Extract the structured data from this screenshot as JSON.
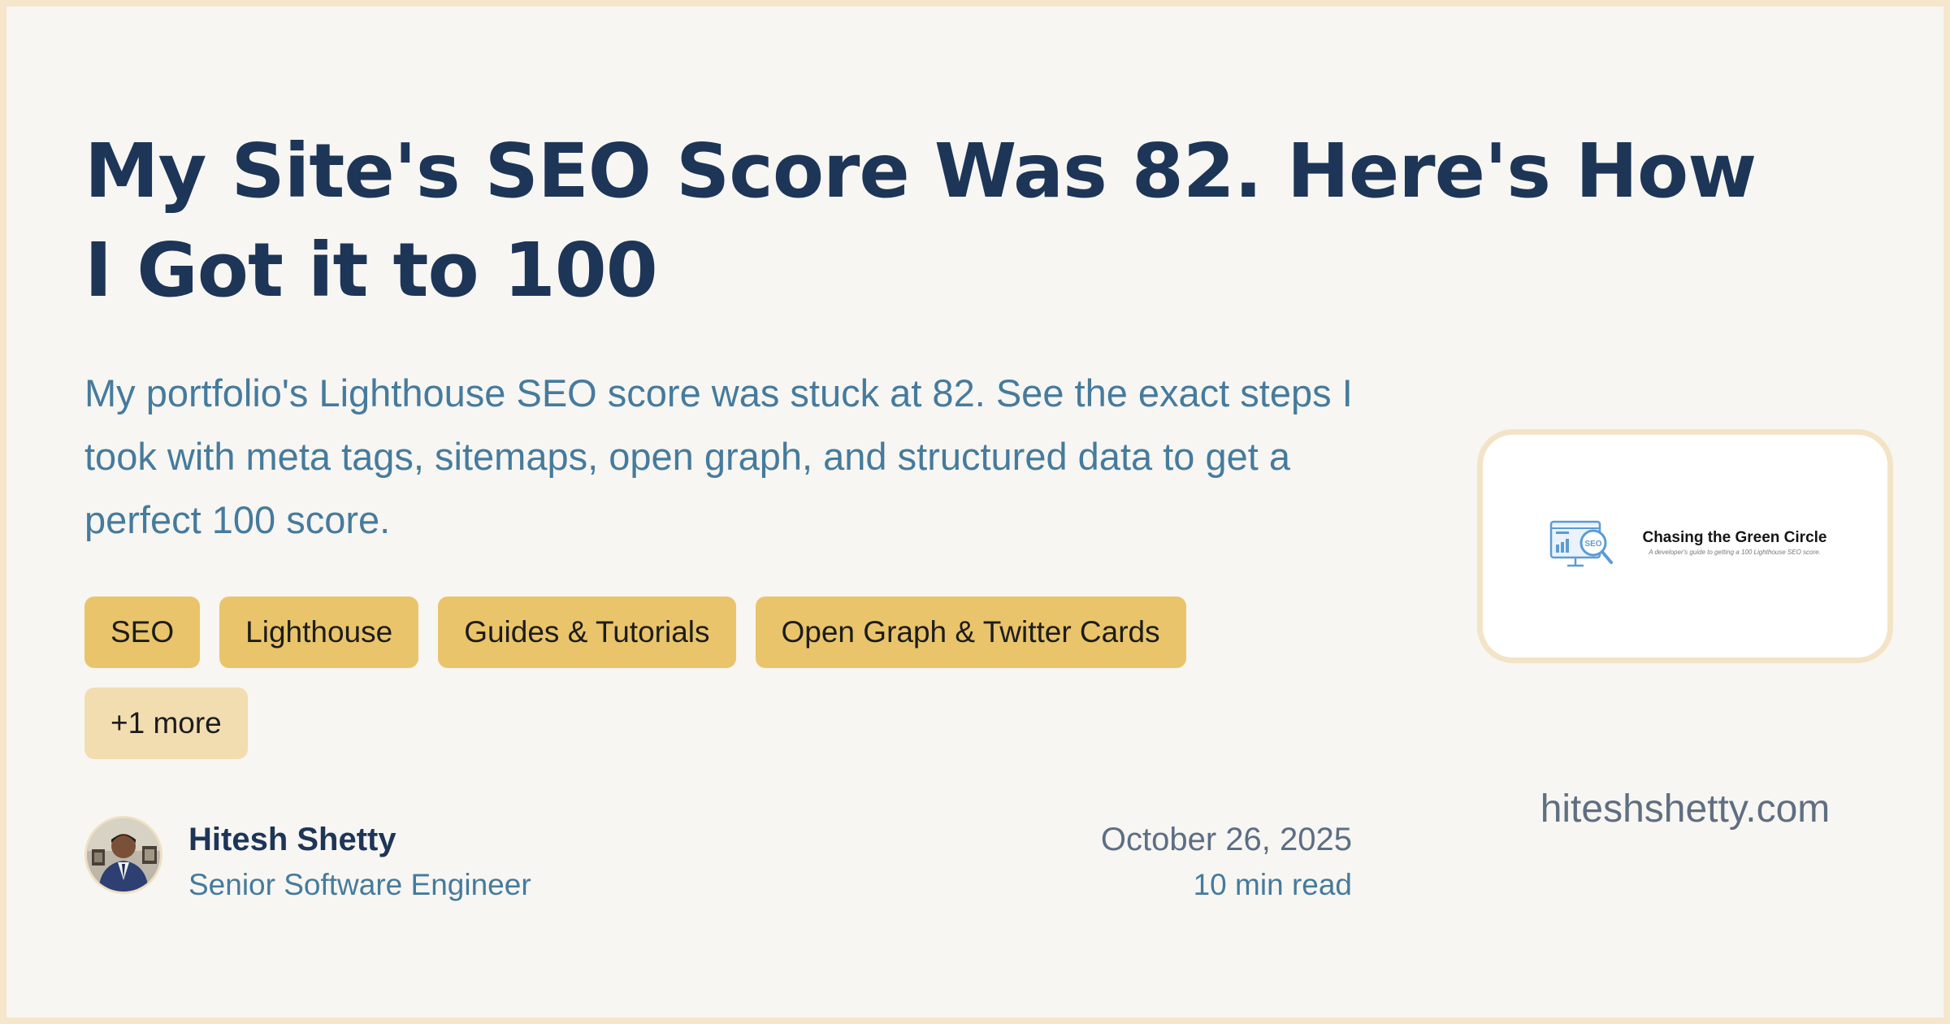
{
  "post": {
    "title": "My Site's SEO Score Was 82. Here's How I Got it to 100",
    "description": "My portfolio's Lighthouse SEO score was stuck at 82. See the exact steps I took with meta tags, sitemaps, open graph, and structured data to get a perfect 100 score.",
    "tags": [
      {
        "label": "SEO"
      },
      {
        "label": "Lighthouse"
      },
      {
        "label": "Guides & Tutorials"
      },
      {
        "label": "Open Graph & Twitter Cards"
      }
    ],
    "more_tags_label": "+1 more",
    "date": "October 26, 2025",
    "read_time": "10 min read"
  },
  "author": {
    "name": "Hitesh Shetty",
    "role": "Senior Software Engineer",
    "avatar_icon": "person-photo-icon"
  },
  "cover": {
    "icon": "seo-monitor-magnifier-icon",
    "icon_label": "SEO",
    "title": "Chasing the Green Circle",
    "subtitle": "A developer's guide to getting a 100 Lighthouse SEO score."
  },
  "site": {
    "domain": "hiteshshetty.com"
  },
  "colors": {
    "frame": "#f5e6cc",
    "background": "#f8f6f2",
    "title": "#1d3557",
    "accent_text": "#457b9d",
    "tag": "#e9c46a",
    "tag_more": "#f2ddb1",
    "muted_text": "#5f6f82"
  }
}
